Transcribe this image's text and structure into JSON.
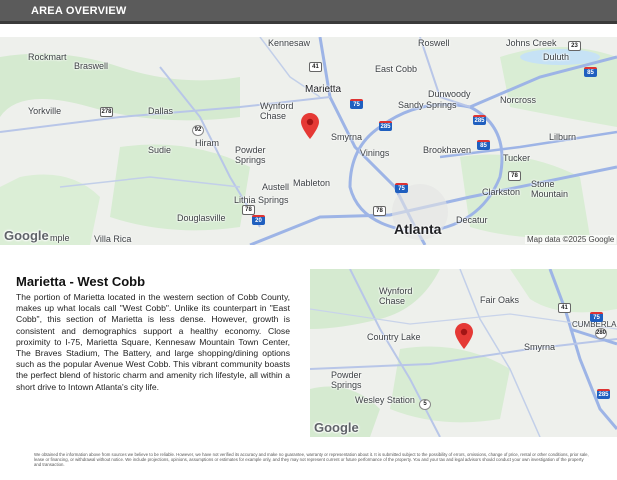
{
  "header": {
    "title": "AREA OVERVIEW"
  },
  "map_large": {
    "labels": {
      "kennesaw": "Kennesaw",
      "roswell": "Roswell",
      "johns_creek": "Johns Creek",
      "rockmart": "Rockmart",
      "braswell": "Braswell",
      "marietta": "Marietta",
      "east_cobb": "East Cobb",
      "duluth": "Duluth",
      "dunwoody": "Dunwoody",
      "yorkville": "Yorkville",
      "dallas": "Dallas",
      "wynford_chase": "Wynford\nChase",
      "sandy_springs": "Sandy Springs",
      "norcross": "Norcross",
      "smyrna": "Smyrna",
      "lilburn": "Lilburn",
      "sudie": "Sudie",
      "hiram": "Hiram",
      "powder_springs": "Powder\nSprings",
      "vinings": "Vinings",
      "brookhaven": "Brookhaven",
      "tucker": "Tucker",
      "austell": "Austell",
      "mableton": "Mableton",
      "clarkston": "Clarkston",
      "stone_mountain": "Stone\nMountain",
      "lithia_springs": "Lithia Springs",
      "douglasville": "Douglasville",
      "decatur": "Decatur",
      "temple": "mple",
      "villa_rica": "Villa Rica",
      "atlanta": "Atlanta"
    },
    "shields": {
      "i23": "23",
      "i41": "41",
      "i75a": "75",
      "i85a": "85",
      "i285a": "285",
      "i285b": "285",
      "u278": "278",
      "u92": "92",
      "i85b": "85",
      "i75b": "75",
      "u78a": "78",
      "u78b": "78",
      "i20": "20",
      "u78c": "78"
    },
    "google": "Google",
    "map_data": "Map data ©2025 Google"
  },
  "map_small": {
    "labels": {
      "wynford_chase": "Wynford\nChase",
      "fair_oaks": "Fair Oaks",
      "cumberland": "CUMBERLAN",
      "country_lake": "Country Lake",
      "smyrna": "Smyrna",
      "powder_springs": "Powder\nSprings",
      "wesley_station": "Wesley Station"
    },
    "shields": {
      "u41": "41",
      "i75": "75",
      "s280": "280",
      "s5": "5",
      "i285": "285"
    },
    "google": "Google"
  },
  "section": {
    "title": "Marietta - West Cobb",
    "body": "The portion of Marietta located in the western section of Cobb County, makes up what locals call \"West Cobb\". Unlike its counterpart in \"East Cobb\", this section of Marietta is less dense. However, growth is consistent and demographics support a healthy economy. Close proximity to I-75, Marietta Square, Kennesaw Mountain Town Center, The Braves Stadium, The Battery, and large shopping/dining options such as the popular Avenue West Cobb. This vibrant community boasts the perfect blend of historic charm and amenity rich lifestyle, all within a short drive to Intown Atlanta's city life."
  },
  "disclaimer": "We obtained the information above from sources we believe to be reliable. However, we have not verified its accuracy and make no guarantee, warranty or representation about it. It is submitted subject to the possibility of errors, omissions, change of price, rental or other conditions, prior sale, lease or financing, or withdrawal without notice. We include projections, opinions, assumptions or estimates for example only, and they may not represent current or future performance of the property. You and your tax and legal advisors should conduct your own investigation of the property and transaction.",
  "colors": {
    "header_bg": "#5b5b5b",
    "pin": "#e53935",
    "interstate": "#1f5fbf",
    "land": "#eef0ec",
    "park": "#cfe8c6",
    "road": "#a9bde6",
    "water": "#aadaff"
  }
}
